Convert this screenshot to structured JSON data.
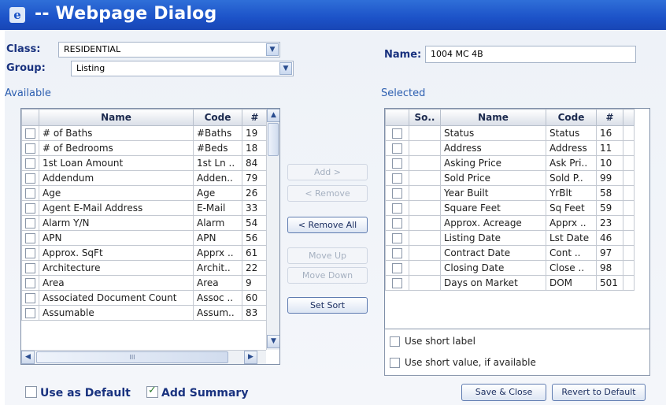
{
  "window": {
    "title": "-- Webpage Dialog",
    "icon": "ie-page-icon"
  },
  "filters": {
    "class_label": "Class:",
    "class_value": "RESIDENTIAL",
    "group_label": "Group:",
    "group_value": "Listing",
    "name_label": "Name:",
    "name_value": "1004 MC 4B"
  },
  "available": {
    "title": "Available",
    "columns": [
      "Name",
      "Code",
      "#"
    ],
    "rows": [
      {
        "name": "# of Baths",
        "code": "#Baths",
        "num": "19"
      },
      {
        "name": "# of Bedrooms",
        "code": "#Beds",
        "num": "18"
      },
      {
        "name": "1st Loan Amount",
        "code": "1st Ln ..",
        "num": "84"
      },
      {
        "name": "Addendum",
        "code": "Adden..",
        "num": "79"
      },
      {
        "name": "Age",
        "code": "Age",
        "num": "26"
      },
      {
        "name": "Agent E-Mail Address",
        "code": "E-Mail",
        "num": "33"
      },
      {
        "name": "Alarm Y/N",
        "code": "Alarm",
        "num": "54"
      },
      {
        "name": "APN",
        "code": "APN",
        "num": "56"
      },
      {
        "name": "Approx. SqFt",
        "code": "Apprx ..",
        "num": "61"
      },
      {
        "name": "Architecture",
        "code": "Archit..",
        "num": "22"
      },
      {
        "name": "Area",
        "code": "Area",
        "num": "9"
      },
      {
        "name": "Associated Document Count",
        "code": "Assoc ..",
        "num": "60"
      },
      {
        "name": "Assumable",
        "code": "Assum..",
        "num": "83"
      }
    ]
  },
  "actions": {
    "add": "Add >",
    "remove": "< Remove",
    "remove_all": "< Remove All",
    "move_up": "Move Up",
    "move_down": "Move Down",
    "set_sort": "Set Sort"
  },
  "selected": {
    "title": "Selected",
    "columns": [
      "So..",
      "Name",
      "Code",
      "#"
    ],
    "rows": [
      {
        "sort": "",
        "name": "Status",
        "code": "Status",
        "num": "16"
      },
      {
        "sort": "",
        "name": "Address",
        "code": "Address",
        "num": "11"
      },
      {
        "sort": "",
        "name": "Asking Price",
        "code": "Ask Pri..",
        "num": "10"
      },
      {
        "sort": "",
        "name": "Sold Price",
        "code": "Sold P..",
        "num": "99"
      },
      {
        "sort": "",
        "name": "Year Built",
        "code": "YrBlt",
        "num": "58"
      },
      {
        "sort": "",
        "name": "Square Feet",
        "code": "Sq Feet",
        "num": "59"
      },
      {
        "sort": "",
        "name": "Approx. Acreage",
        "code": "Apprx ..",
        "num": "23"
      },
      {
        "sort": "",
        "name": "Listing Date",
        "code": "Lst Date",
        "num": "46"
      },
      {
        "sort": "",
        "name": "Contract Date",
        "code": "Cont ..",
        "num": "97"
      },
      {
        "sort": "",
        "name": "Closing Date",
        "code": "Close ..",
        "num": "98"
      },
      {
        "sort": "",
        "name": "Days on Market",
        "code": "DOM",
        "num": "501"
      }
    ]
  },
  "options": {
    "short_label": "Use short label",
    "short_value": "Use short value, if available"
  },
  "footer": {
    "use_default": "Use as Default",
    "use_default_checked": false,
    "add_summary": "Add Summary",
    "add_summary_checked": true,
    "save_close": "Save & Close",
    "revert": "Revert to Default"
  },
  "scroll_glyph": "III"
}
